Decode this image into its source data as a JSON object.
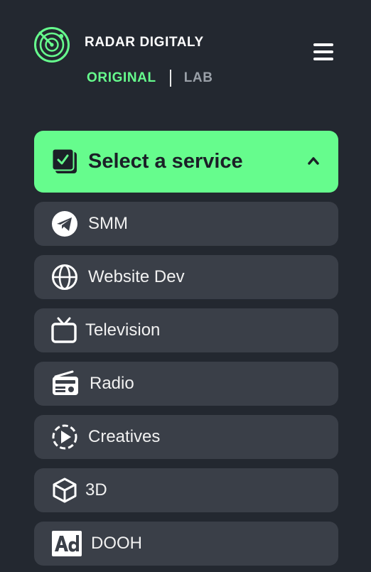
{
  "header": {
    "brand": "RADAR DIGITALY",
    "toggle": {
      "original": "ORIGINAL",
      "lab": "LAB",
      "active": "original"
    },
    "icons": {
      "logo": "radar-logo-icon",
      "menu": "hamburger-menu-icon"
    }
  },
  "colors": {
    "background": "#232830",
    "accent": "#66fc8d",
    "item_background": "#3a3f48",
    "muted": "#9aa0a8"
  },
  "service_select": {
    "label": "Select a service",
    "icon": "checkbox-icon",
    "expanded": true
  },
  "services": [
    {
      "label": "SMM",
      "icon": "telegram-icon"
    },
    {
      "label": "Website Dev",
      "icon": "globe-icon"
    },
    {
      "label": "Television",
      "icon": "tv-icon"
    },
    {
      "label": "Radio",
      "icon": "radio-icon"
    },
    {
      "label": "Creatives",
      "icon": "play-circle-icon"
    },
    {
      "label": "3D",
      "icon": "cube-icon"
    },
    {
      "label": "DOOH",
      "icon": "ad-icon"
    }
  ]
}
